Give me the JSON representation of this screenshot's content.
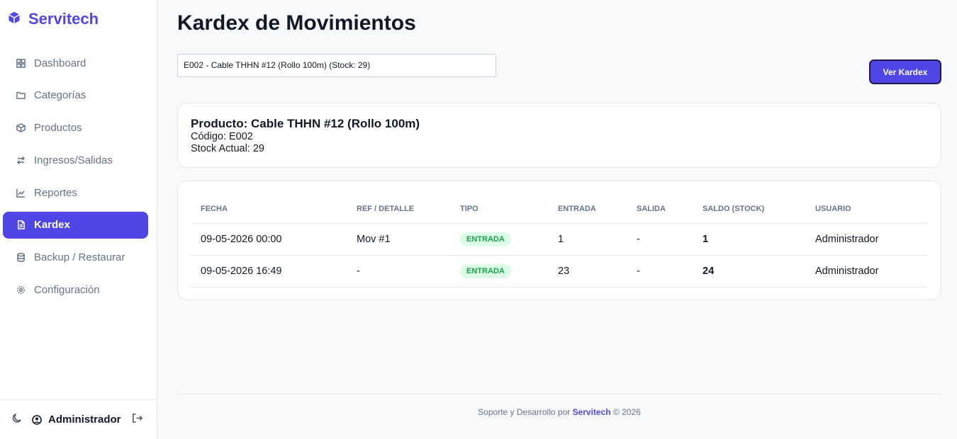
{
  "sidebar": {
    "brand": "Servitech",
    "items": [
      {
        "label": "Dashboard",
        "icon": "grid-icon"
      },
      {
        "label": "Categorías",
        "icon": "folder-icon"
      },
      {
        "label": "Productos",
        "icon": "box-icon"
      },
      {
        "label": "Ingresos/Salidas",
        "icon": "arrows-icon"
      },
      {
        "label": "Reportes",
        "icon": "chart-icon"
      },
      {
        "label": "Kardex",
        "icon": "file-icon",
        "active": true
      },
      {
        "label": "Backup / Restaurar",
        "icon": "database-icon"
      },
      {
        "label": "Configuración",
        "icon": "gear-icon"
      }
    ],
    "user": "Administrador"
  },
  "main": {
    "title": "Kardex de Movimientos",
    "select_value": "E002 - Cable THHN #12 (Rollo 100m) (Stock: 29)",
    "button_label": "Ver Kardex",
    "product": {
      "title": "Producto: Cable THHN #12 (Rollo 100m)",
      "code": "Código: E002",
      "stock": "Stock Actual: 29"
    },
    "table": {
      "headers": [
        "FECHA",
        "REF / DETALLE",
        "TIPO",
        "ENTRADA",
        "SALIDA",
        "SALDO (STOCK)",
        "USUARIO"
      ],
      "rows": [
        [
          "09-05-2026 00:00",
          "Mov #1",
          "ENTRADA",
          "1",
          "-",
          "1",
          "Administrador"
        ],
        [
          "09-05-2026 16:49",
          "-",
          "ENTRADA",
          "23",
          "-",
          "24",
          "Administrador"
        ]
      ]
    }
  },
  "footer": {
    "prefix": "Soporte y Desarrollo por",
    "brand": "Servitech",
    "suffix": "© 2026"
  },
  "colors": {
    "accent": "#4f46e5",
    "badge_bg": "#dcfce7",
    "badge_text": "#16a34a"
  }
}
